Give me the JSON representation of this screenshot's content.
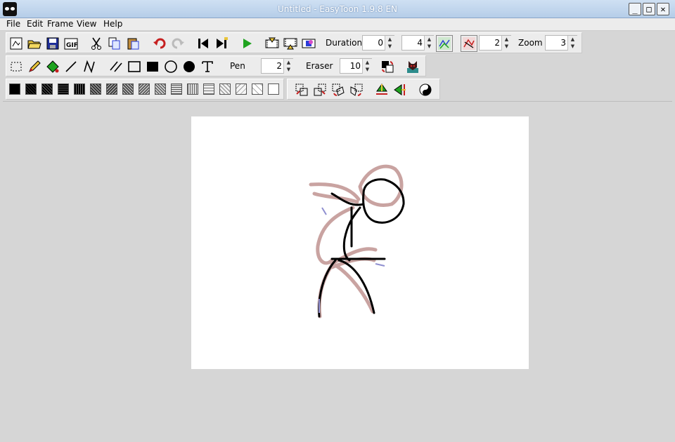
{
  "window": {
    "title": "Untitled - EasyToon 1.9.8 EN",
    "minimize": "_",
    "maximize": "□",
    "close": "✕"
  },
  "menu": [
    "File",
    "Edit",
    "Frame",
    "View",
    "Help"
  ],
  "toolbar1": {
    "duration_label": "Duration",
    "duration_value": "0",
    "frame_value": "4",
    "onion_value": "2",
    "zoom_label": "Zoom",
    "zoom_value": "3"
  },
  "toolbar2": {
    "pen_label": "Pen",
    "pen_value": "2",
    "eraser_label": "Eraser",
    "eraser_value": "10"
  },
  "colors": {
    "accent_green": "#1fa31f",
    "red_icon": "#c62020",
    "onion_pink": "#c9a3a1",
    "stroke": "#000000",
    "blue_icon": "#2a3dd8"
  }
}
